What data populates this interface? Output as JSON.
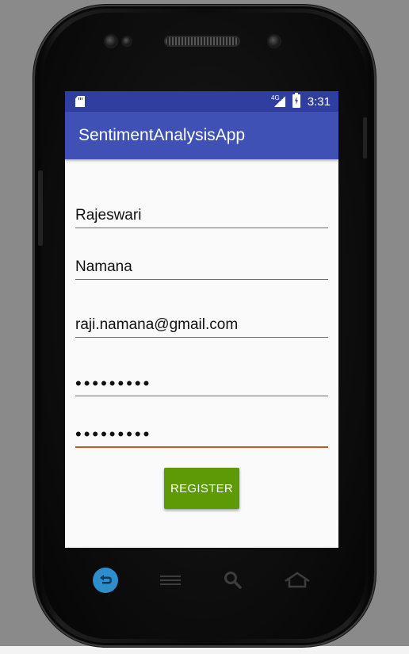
{
  "status_bar": {
    "network": "4G",
    "time": "3:31"
  },
  "app_bar": {
    "title": "SentimentAnalysisApp"
  },
  "form": {
    "first_name": "Rajeswari",
    "last_name": "Namana",
    "email": "raji.namana@gmail.com",
    "password": "•••••••••",
    "confirm_password": "•••••••••"
  },
  "buttons": {
    "register_label": "REGISTER"
  },
  "colors": {
    "status_bar": "#303f9f",
    "app_bar": "#3f51b5",
    "register_button": "#5e9a05",
    "focused_underline": "#d0561e",
    "back_button": "#2d8ecb"
  },
  "nav_bar": {
    "icons": [
      "back-icon",
      "menu-icon",
      "search-icon",
      "home-icon"
    ]
  }
}
